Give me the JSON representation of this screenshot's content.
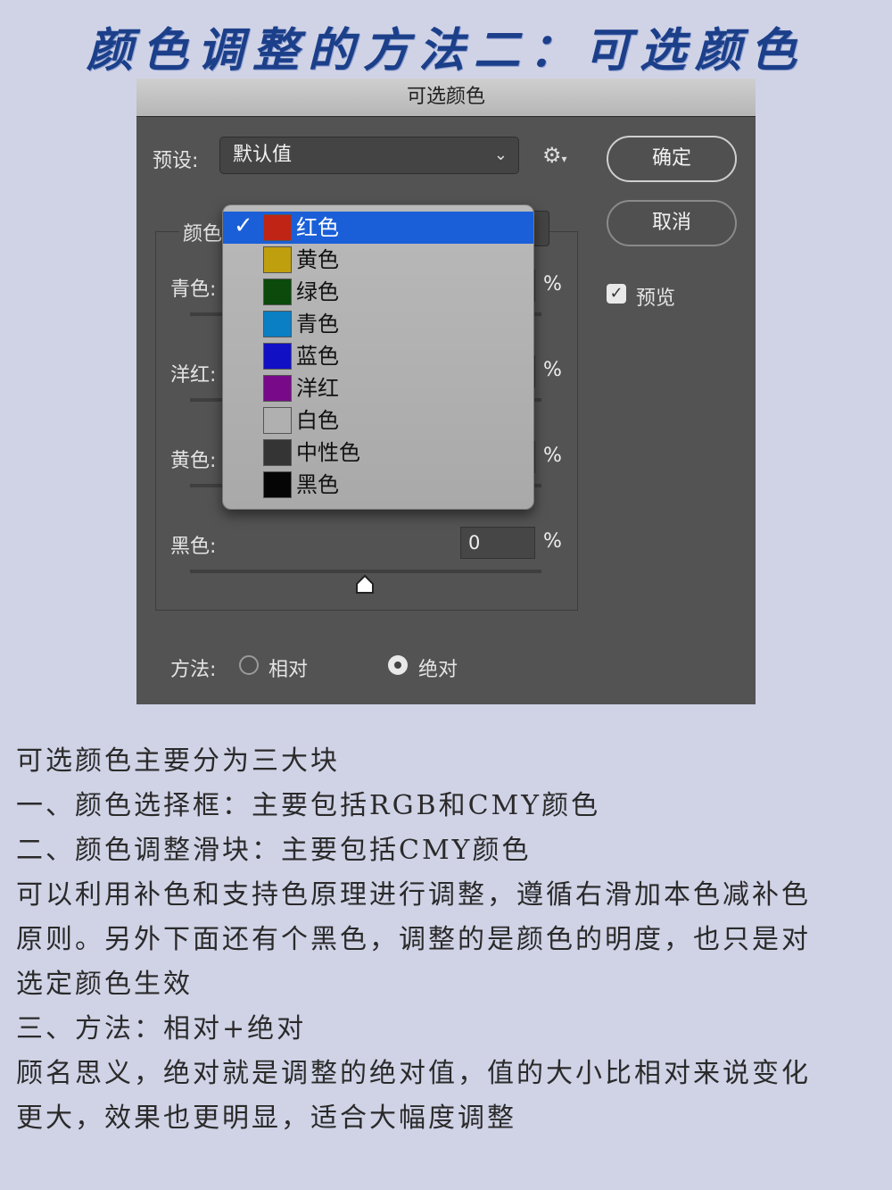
{
  "page_title": "颜色调整的方法二：可选颜色",
  "dialog": {
    "title": "可选颜色",
    "preset_label": "预设:",
    "preset_value": "默认值",
    "ok_button": "确定",
    "cancel_button": "取消",
    "preview_label": "预览",
    "preview_checked": true,
    "colors_label": "颜色",
    "sliders": [
      {
        "label": "青色:",
        "value": "",
        "unit": "%"
      },
      {
        "label": "洋红:",
        "value": "",
        "unit": "%"
      },
      {
        "label": "黄色:",
        "value": "",
        "unit": "%"
      },
      {
        "label": "黑色:",
        "value": "0",
        "unit": "%"
      }
    ],
    "method_label": "方法:",
    "method_relative": "相对",
    "method_absolute": "绝对",
    "method_selected": "绝对"
  },
  "dropdown": {
    "selected": "红色",
    "items": [
      {
        "label": "红色",
        "color": "#c02414"
      },
      {
        "label": "黄色",
        "color": "#c09f0e"
      },
      {
        "label": "绿色",
        "color": "#0b4a0b"
      },
      {
        "label": "青色",
        "color": "#0a7fc4"
      },
      {
        "label": "蓝色",
        "color": "#1210c4"
      },
      {
        "label": "洋红",
        "color": "#780a8a"
      },
      {
        "label": "白色",
        "color": "#b0b0b0"
      },
      {
        "label": "中性色",
        "color": "#343434"
      },
      {
        "label": "黑色",
        "color": "#050505"
      }
    ]
  },
  "notes": [
    "可选颜色主要分为三大块",
    "一、颜色选择框：主要包括RGB和CMY颜色",
    "二、颜色调整滑块：主要包括CMY颜色",
    "可以利用补色和支持色原理进行调整，遵循右滑加本色减补色",
    "原则。另外下面还有个黑色，调整的是颜色的明度，也只是对",
    "选定颜色生效",
    "三、方法：相对+绝对",
    "顾名思义，绝对就是调整的绝对值，值的大小比相对来说变化",
    "更大，效果也更明显，适合大幅度调整"
  ]
}
